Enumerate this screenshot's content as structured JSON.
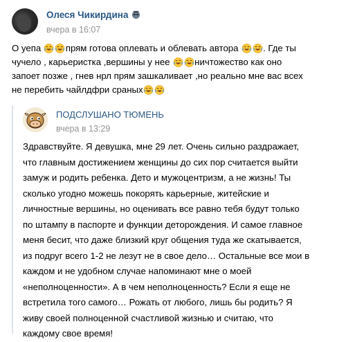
{
  "post": {
    "author": "Олеся Чикирдина",
    "author_badge_icon": "alien-badge-icon",
    "time": "вчера в 16:07",
    "lines": [
      [
        "О уепа ",
        "E",
        "E",
        "прям готова оплевать и облевать автора ",
        "E",
        "E",
        ". Где ты"
      ],
      [
        "чучело , карьеристка ,вершины у нее ",
        "E",
        "E",
        "ничтожество как оно"
      ],
      [
        "запоет позже , гнев нрл прям зашкаливает ,но реально мне вас всех"
      ],
      [
        "не перебить чайлдфри сраных",
        "E",
        "E"
      ]
    ],
    "emoji_name": "tears-of-joy-emoji"
  },
  "repost": {
    "group_name": "ПОДСЛУШАНО ТЮМЕНЬ",
    "time": "вчера в 13:29",
    "lines": [
      "Здравствуйте. Я девушка, мне 29 лет. Очень сильно раздражает,",
      "что главным достижением женщины до сих пор считается выйти",
      "замуж и родить ребенка. Дето и мужоцентризм, а не жизнь! Ты",
      "сколько угодно можешь покорять карьерные, житейские и",
      "личностные вершины, но оценивать все равно тебя будут только",
      "по штампу в паспорте и функции деторождения. И самое главное",
      "меня бесит, что даже близкий круг общения туда же скатывается,",
      "из подруг всего 1-2 не лезут не в свое дело… Остальные все мои в",
      "каждом и не удобном случае напоминают мне о моей",
      "«неполноценности». А в чем неполноценность? Если я еще не",
      "встретила того самого… Рожать от любого, лишь бы родить? Я",
      "живу своей полноценной счастливой жизнью и считаю, что",
      "каждому свое время!"
    ]
  },
  "colors": {
    "link": "#2a5885",
    "secondary_text": "#939393",
    "repost_bar": "#dde2e8",
    "emoji_face": "#f9c83b",
    "emoji_tears": "#4ea6e8"
  }
}
